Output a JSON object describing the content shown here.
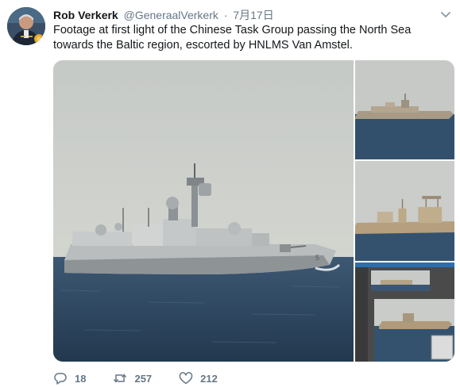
{
  "tweet": {
    "author_name": "Rob Verkerk",
    "author_handle": "@GeneraalVerkerk",
    "separator": "·",
    "timestamp": "7月17日",
    "text": "Footage at first light of the Chinese Task Group passing the North Sea towards the Baltic region, escorted by HNLMS Van Amstel."
  },
  "icons": {
    "avatar": "avatar-portrait",
    "menu": "chevron-down-icon",
    "reply": "reply-icon",
    "retweet": "retweet-icon",
    "like": "heart-icon"
  },
  "stats": {
    "replies": "18",
    "retweets": "257",
    "likes": "212"
  },
  "media": {
    "count": 4
  },
  "colors": {
    "text": "#14171a",
    "muted": "#657786",
    "sky": "#c9ccc8",
    "sea": "#2f4b66"
  }
}
